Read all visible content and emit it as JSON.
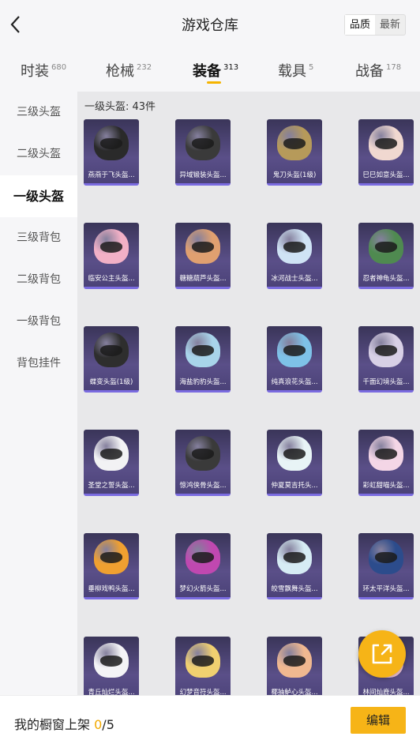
{
  "header": {
    "title": "游戏仓库",
    "sort_quality": "品质",
    "sort_latest": "最新"
  },
  "tabs": [
    {
      "label": "时装",
      "count": "680"
    },
    {
      "label": "枪械",
      "count": "232"
    },
    {
      "label": "装备",
      "count": "313"
    },
    {
      "label": "载具",
      "count": "5"
    },
    {
      "label": "战备",
      "count": "178"
    }
  ],
  "sidebar": {
    "items": [
      "三级头盔",
      "二级头盔",
      "一级头盔",
      "三级背包",
      "二级背包",
      "一级背包",
      "背包挂件"
    ],
    "active": "一级头盔"
  },
  "content": {
    "count_label": "一级头盔: 43件"
  },
  "items": [
    {
      "name": "燕燕于飞头盔...",
      "color": "#2a2a2a"
    },
    {
      "name": "异域锻装头盔...",
      "color": "#3a3a3a"
    },
    {
      "name": "鬼刀头盔(1级)",
      "color": "#b69a5a"
    },
    {
      "name": "巳巳如意头盔...",
      "color": "#f0d8d0"
    },
    {
      "name": "临安公主头盔...",
      "color": "#f2b0c6"
    },
    {
      "name": "糖糖葫芦头盔...",
      "color": "#e0a070"
    },
    {
      "name": "冰河战士头盔...",
      "color": "#cfe3f5"
    },
    {
      "name": "忍者神龟头盔...",
      "color": "#4f8a50"
    },
    {
      "name": "蝶变头盔(1级)",
      "color": "#2e2e2e"
    },
    {
      "name": "海盐豹豹头盔...",
      "color": "#a8d4ea"
    },
    {
      "name": "纯真浪花头盔...",
      "color": "#7ec2e8"
    },
    {
      "name": "千面幻境头盔...",
      "color": "#d8d0e6"
    },
    {
      "name": "圣堂之誓头盔...",
      "color": "#f2f2f4"
    },
    {
      "name": "惊鸿侠骨头盔...",
      "color": "#3a3a3a"
    },
    {
      "name": "仲夏莫吉托头...",
      "color": "#e8f4f6"
    },
    {
      "name": "彩虹甜喵头盔...",
      "color": "#f4d6e6"
    },
    {
      "name": "垂柳戏鸭头盔...",
      "color": "#f0a030"
    },
    {
      "name": "梦幻火箭头盔...",
      "color": "#c048b0"
    },
    {
      "name": "皎雪飘舞头盔...",
      "color": "#d6ecf4"
    },
    {
      "name": "环太平洋头盔...",
      "color": "#2c4c8c"
    },
    {
      "name": "青丘灿烂头盔...",
      "color": "#f4f4f6"
    },
    {
      "name": "幻梦音符头盔...",
      "color": "#f0d070"
    },
    {
      "name": "椰抽鲈心头盔...",
      "color": "#f0b890"
    },
    {
      "name": "林间灿鹿头盔...",
      "color": "#f4c6d6"
    }
  ],
  "bottom": {
    "shelf_label": "我的橱窗上架",
    "shelf_current": "0",
    "shelf_total": "/5",
    "edit_label": "编辑"
  }
}
